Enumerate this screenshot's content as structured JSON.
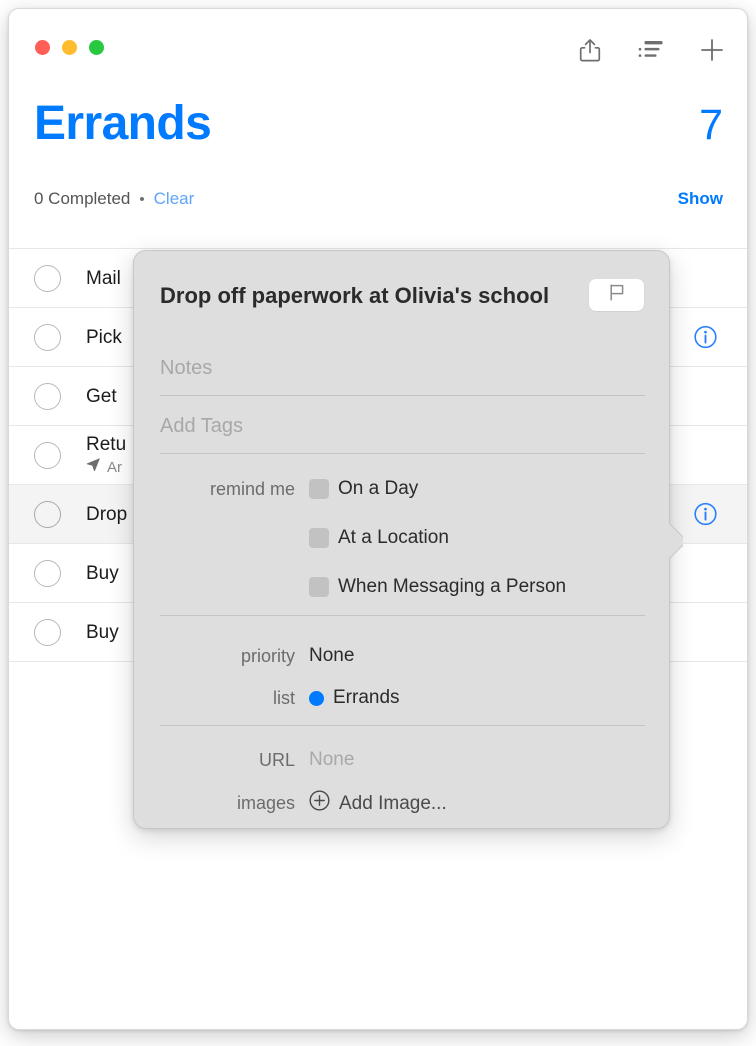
{
  "window": {
    "traffic_lights": [
      {
        "name": "close",
        "color": "#ff5f57"
      },
      {
        "name": "minimize",
        "color": "#febc2e"
      },
      {
        "name": "zoom",
        "color": "#28c840"
      }
    ]
  },
  "toolbar": {
    "share_icon": "share-icon",
    "sort_icon": "list-sort-icon",
    "add_icon": "plus-icon"
  },
  "header": {
    "title": "Errands",
    "count": "7",
    "completed_text": "0 Completed",
    "separator_dot": "•",
    "clear_label": "Clear",
    "show_label": "Show",
    "accent_color": "#007aff"
  },
  "reminders": [
    {
      "title": "Mail",
      "sub": "",
      "has_info": false,
      "selected": false
    },
    {
      "title": "Pick",
      "sub": "",
      "has_info": true,
      "selected": false
    },
    {
      "title": "Get ",
      "sub": "",
      "has_info": false,
      "selected": false
    },
    {
      "title": "Retu",
      "sub": "Ar",
      "has_info": false,
      "selected": false
    },
    {
      "title": "Drop",
      "sub": "",
      "has_info": true,
      "selected": true
    },
    {
      "title": "Buy ",
      "sub": "",
      "has_info": false,
      "selected": false
    },
    {
      "title": "Buy ",
      "sub": "",
      "has_info": false,
      "selected": false
    }
  ],
  "popover": {
    "title": "Drop off paperwork at Olivia's school",
    "flag_icon": "flag-icon",
    "notes_placeholder": "Notes",
    "tags_placeholder": "Add Tags",
    "remind_me_label": "remind me",
    "remind_options": [
      {
        "label": "On a Day",
        "checked": false
      },
      {
        "label": "At a Location",
        "checked": false
      },
      {
        "label": "When Messaging a Person",
        "checked": false
      }
    ],
    "priority_label": "priority",
    "priority_value": "None",
    "list_label": "list",
    "list_value": "Errands",
    "list_color": "#007aff",
    "url_label": "URL",
    "url_value": "None",
    "images_label": "images",
    "add_image_label": "Add Image...",
    "add_image_icon": "plus-circle-icon"
  }
}
